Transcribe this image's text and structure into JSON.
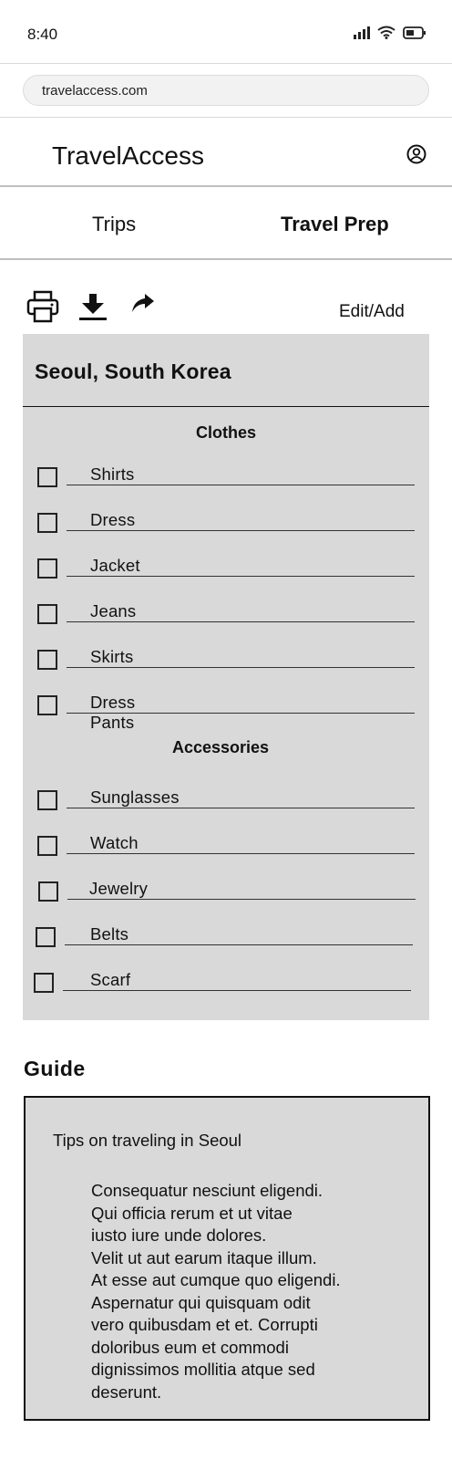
{
  "status_bar": {
    "time": "8:40"
  },
  "browser": {
    "url": "travelaccess.com"
  },
  "header": {
    "brand": "TravelAccess"
  },
  "tabs": [
    {
      "label": "Trips",
      "active": false
    },
    {
      "label": "Travel Prep",
      "active": true
    }
  ],
  "toolbar": {
    "edit_add_label": "Edit/Add"
  },
  "packing_list": {
    "title": "Seoul, South Korea",
    "sections": [
      {
        "title": "Clothes",
        "items": [
          "Shirts",
          "Dress",
          "Jacket",
          "Jeans",
          "Skirts",
          "Dress Pants"
        ]
      },
      {
        "title": "Accessories",
        "items": [
          "Sunglasses",
          "Watch",
          "Jewelry",
          "Belts",
          "Scarf"
        ]
      }
    ]
  },
  "guide": {
    "heading": "Guide",
    "subtitle": "Tips on traveling in Seoul",
    "body": "Consequatur nesciunt eligendi.\n Qui officia rerum et ut vitae\niusto iure unde dolores.\nVelit ut aut earum itaque illum.\nAt esse aut cumque quo eligendi.\nAspernatur qui quisquam odit\nvero quibusdam et et. Corrupti\ndoloribus eum et commodi\ndignissimos mollitia atque sed\ndeserunt."
  },
  "colors": {
    "card_background": "#d9d9d9",
    "text": "#111111",
    "divider": "#bfbfbf"
  }
}
